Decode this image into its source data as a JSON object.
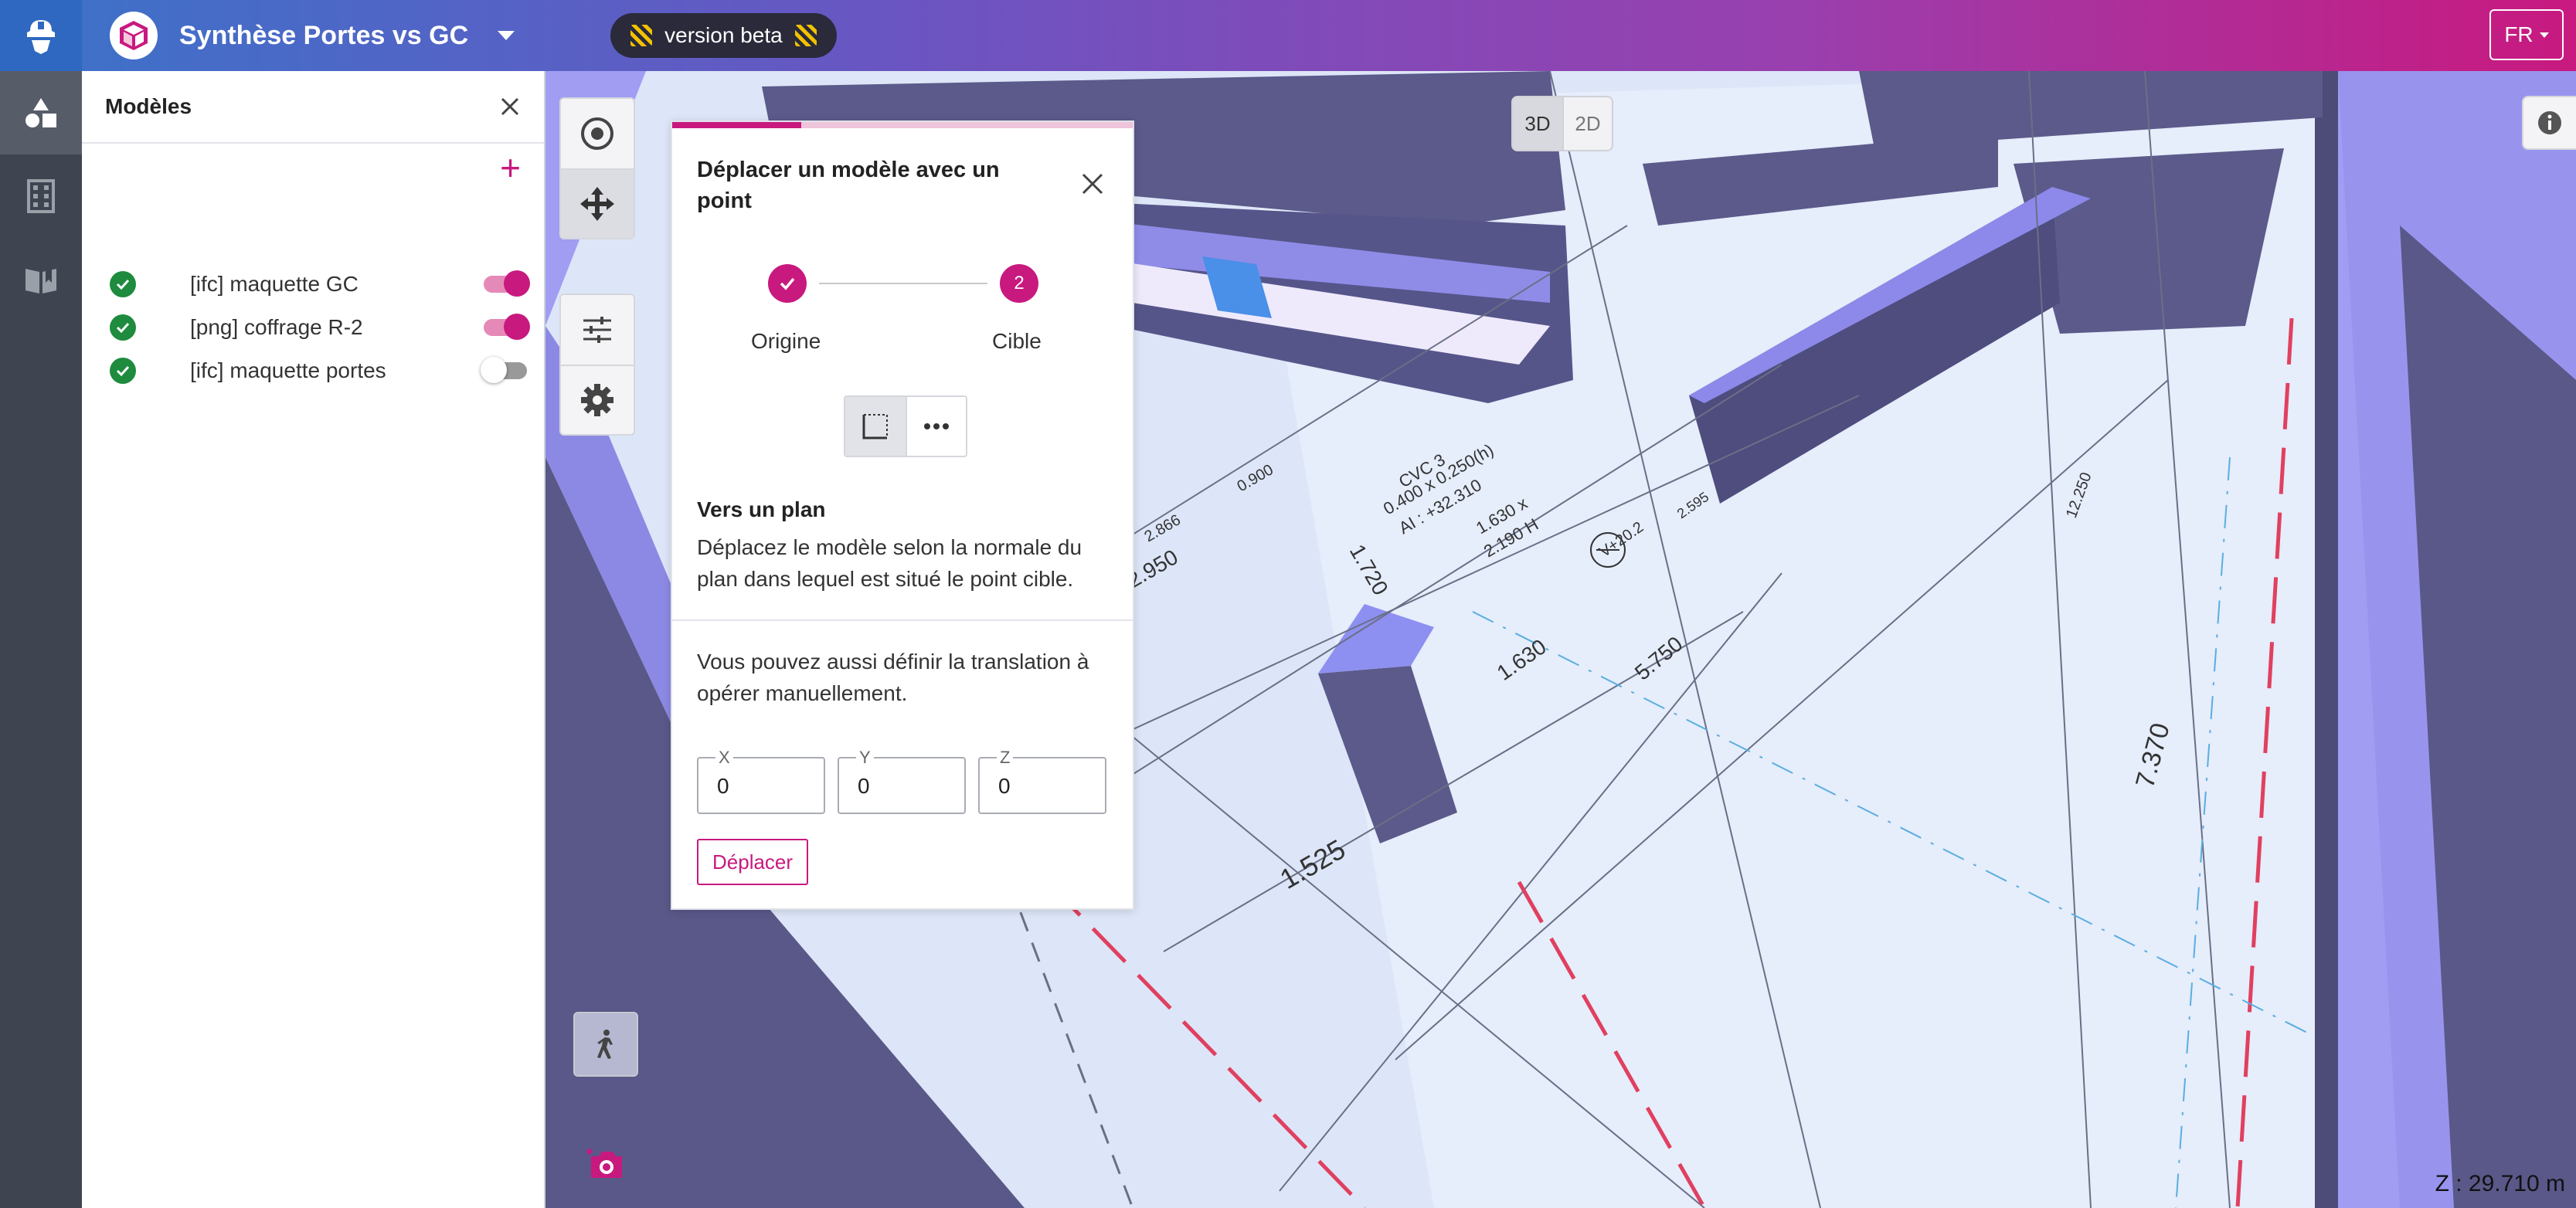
{
  "header": {
    "project_title": "Synthèse Portes vs GC",
    "beta_label": "version beta",
    "language": "FR"
  },
  "models_panel": {
    "title": "Modèles",
    "items": [
      {
        "name": "[ifc] maquette GC",
        "enabled": true
      },
      {
        "name": "[png] coffrage R-2",
        "enabled": true
      },
      {
        "name": "[ifc] maquette portes",
        "enabled": false
      }
    ]
  },
  "viewer": {
    "view_modes": [
      "3D",
      "2D"
    ],
    "selected_view": "3D",
    "z_readout": "Z : 29.710 m",
    "plan_labels": [
      "2.950",
      "1.630",
      "5.750",
      "1.525",
      "7.370",
      "1.720",
      "CVC 3",
      "0.400 x 0.250(h)",
      "AI : +32.310",
      "1.630 x",
      "2.190 H",
      "V+20.2",
      "2.595",
      "0.900",
      "2.866",
      "12.250"
    ]
  },
  "dialog": {
    "title": "Déplacer un modèle avec un point",
    "progress_fraction": 0.28,
    "steps": [
      {
        "label": "Origine",
        "state": "done"
      },
      {
        "label": "Cible",
        "number": "2",
        "state": "current"
      }
    ],
    "section_title": "Vers un plan",
    "section_text": "Déplacez le modèle selon la normale du plan dans lequel est situé le point cible.",
    "manual_text": "Vous pouvez aussi définir la translation à opérer manuellement.",
    "fields": {
      "x": {
        "label": "X",
        "value": "0"
      },
      "y": {
        "label": "Y",
        "value": "0"
      },
      "z": {
        "label": "Z",
        "value": "0"
      }
    },
    "move_button": "Déplacer"
  },
  "colors": {
    "accent": "#c8197f",
    "success": "#1e8b3e",
    "nav_bg": "#3f4550",
    "model_purple": "#5b5a8a"
  }
}
